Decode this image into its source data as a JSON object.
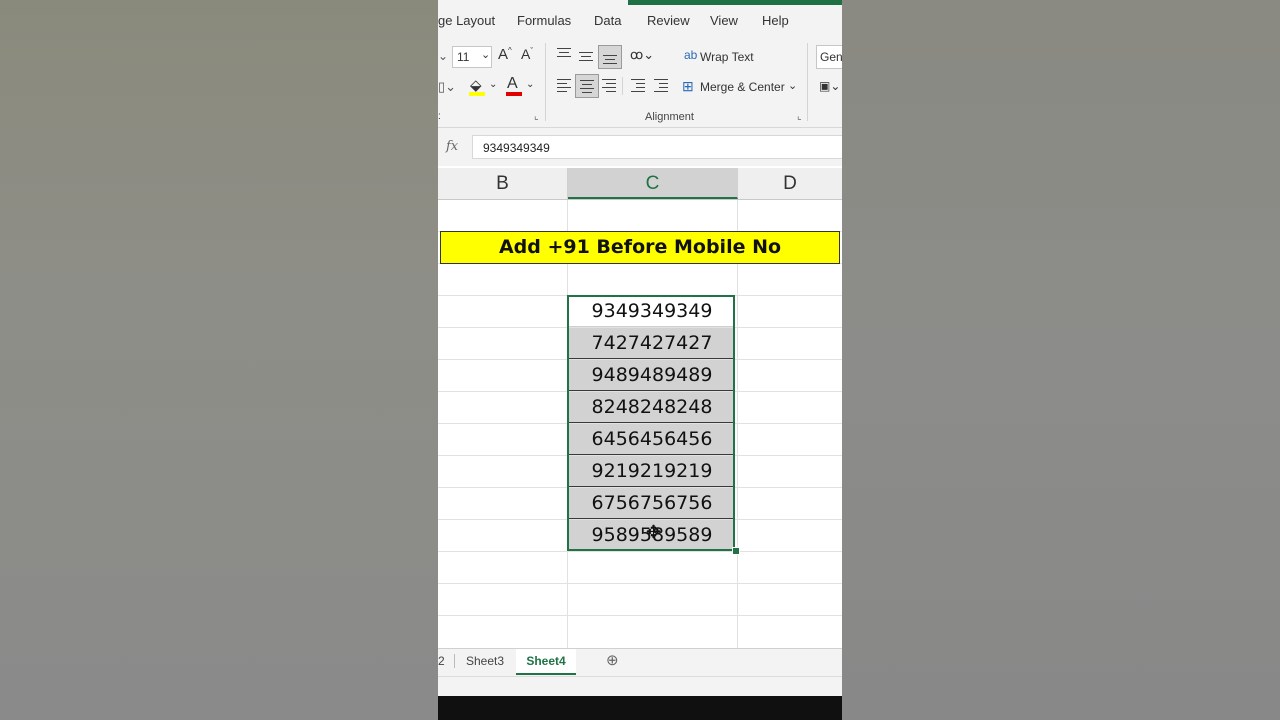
{
  "ribbon": {
    "tabs": [
      "ge Layout",
      "Formulas",
      "Data",
      "Review",
      "View",
      "Help"
    ],
    "font_size": "11",
    "wrap_text": "Wrap Text",
    "merge_center": "Merge & Center",
    "number_format": "Gene",
    "alignment_label": "Alignment"
  },
  "formula_bar": {
    "fx": "fx",
    "value": "9349349349"
  },
  "columns": [
    "B",
    "C",
    "D"
  ],
  "sheet": {
    "title": "Add +91 Before Mobile No",
    "numbers": [
      "9349349349",
      "7427427427",
      "9489489489",
      "8248248248",
      "6456456456",
      "9219219219",
      "6756756756",
      "9589589589"
    ]
  },
  "sheet_tabs": {
    "partial": "2",
    "sheet3": "Sheet3",
    "sheet4": "Sheet4",
    "add": "⊕"
  },
  "colors": {
    "excel_green": "#217346",
    "title_fill": "#ffff00",
    "selection_fill": "#d2d2d2"
  }
}
